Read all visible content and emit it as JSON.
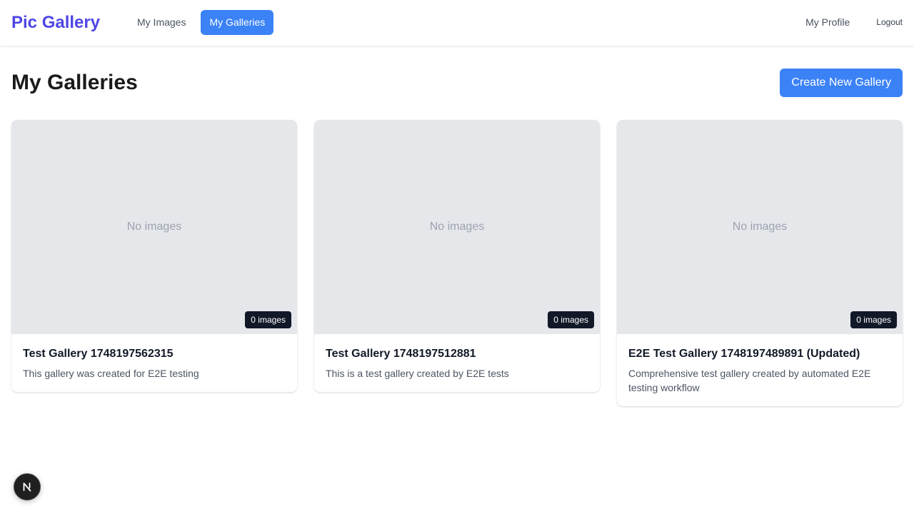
{
  "app": {
    "brand": "Pic Gallery"
  },
  "nav": {
    "items": [
      {
        "label": "My Images",
        "active": false
      },
      {
        "label": "My Galleries",
        "active": true
      }
    ],
    "profile_label": "My Profile",
    "logout_label": "Logout"
  },
  "page": {
    "title": "My Galleries",
    "create_button_label": "Create New Gallery"
  },
  "galleries": [
    {
      "placeholder": "No images",
      "count_label": "0 images",
      "title": "Test Gallery 1748197562315",
      "description": "This gallery was created for E2E testing"
    },
    {
      "placeholder": "No images",
      "count_label": "0 images",
      "title": "Test Gallery 1748197512881",
      "description": "This is a test gallery created by E2E tests"
    },
    {
      "placeholder": "No images",
      "count_label": "0 images",
      "title": "E2E Test Gallery 1748197489891 (Updated)",
      "description": "Comprehensive test gallery created by automated E2E testing workflow"
    }
  ],
  "colors": {
    "brand": "#4f46e5",
    "accent": "#3b82f6",
    "thumbnail_bg": "#e5e7eb",
    "badge_bg": "#111827"
  },
  "icons": {
    "dev_badge": "nextjs-logo-icon"
  }
}
